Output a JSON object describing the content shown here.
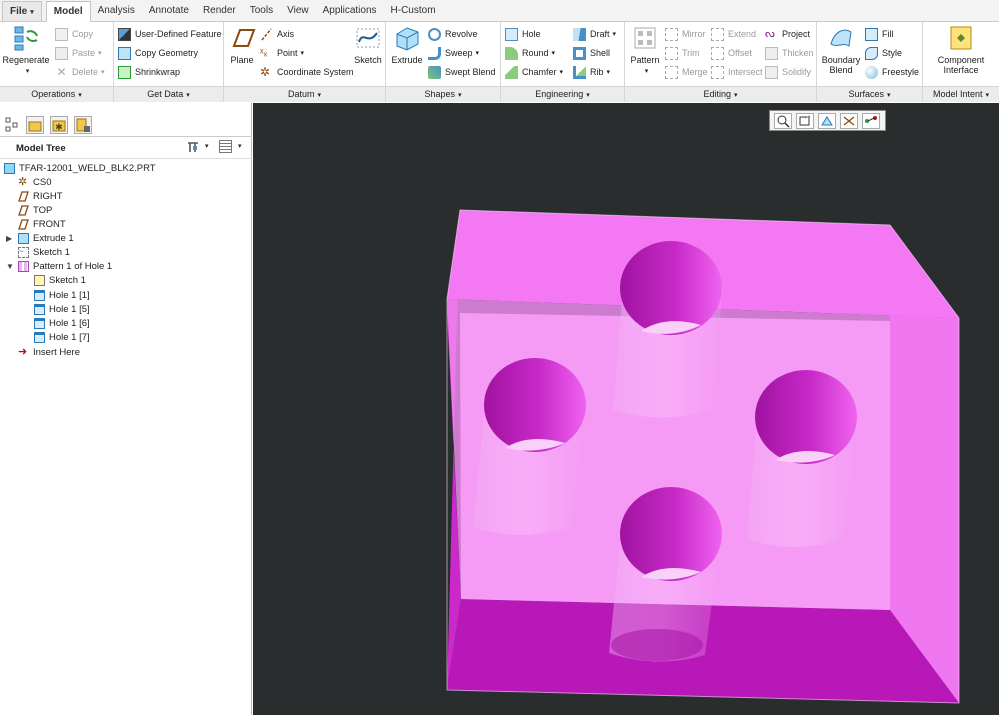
{
  "tabs": [
    "File",
    "Model",
    "Analysis",
    "Annotate",
    "Render",
    "Tools",
    "View",
    "Applications",
    "H-Custom"
  ],
  "ribbon": {
    "operations": {
      "label": "Operations",
      "regenerate": "Regenerate",
      "copy": "Copy",
      "paste": "Paste",
      "delete": "Delete"
    },
    "get_data": {
      "label": "Get Data",
      "udf": "User-Defined Feature",
      "copy_geometry": "Copy Geometry",
      "shrinkwrap": "Shrinkwrap"
    },
    "datum": {
      "label": "Datum",
      "plane": "Plane",
      "axis": "Axis",
      "point": "Point",
      "csys": "Coordinate System",
      "sketch": "Sketch"
    },
    "shapes": {
      "label": "Shapes",
      "extrude": "Extrude",
      "revolve": "Revolve",
      "sweep": "Sweep",
      "swept_blend": "Swept Blend"
    },
    "engineering": {
      "label": "Engineering",
      "hole": "Hole",
      "round": "Round",
      "chamfer": "Chamfer",
      "draft": "Draft",
      "shell": "Shell",
      "rib": "Rib"
    },
    "editing": {
      "label": "Editing",
      "pattern": "Pattern",
      "mirror": "Mirror",
      "trim": "Trim",
      "merge": "Merge",
      "extend": "Extend",
      "offset": "Offset",
      "intersect": "Intersect",
      "project": "Project",
      "thicken": "Thicken",
      "solidify": "Solidify"
    },
    "surfaces": {
      "label": "Surfaces",
      "boundary_blend": "Boundary Blend",
      "fill": "Fill",
      "style": "Style",
      "freestyle": "Freestyle"
    },
    "model_intent": {
      "label": "Model Intent",
      "component_interface": "Component Interface"
    }
  },
  "tree": {
    "title": "Model Tree",
    "items": [
      "TFAR-12001_WELD_BLK2.PRT",
      "CS0",
      "RIGHT",
      "TOP",
      "FRONT",
      "Extrude 1",
      "Sketch 1",
      "Pattern 1 of Hole 1",
      "Sketch 1",
      "Hole 1 [1]",
      "Hole 1 [5]",
      "Hole 1 [6]",
      "Hole 1 [7]",
      "Insert Here"
    ]
  },
  "colors": {
    "model_face": "#f28cf2",
    "model_side": "#e020e0",
    "viewport_bg": "#2a2d2e"
  }
}
